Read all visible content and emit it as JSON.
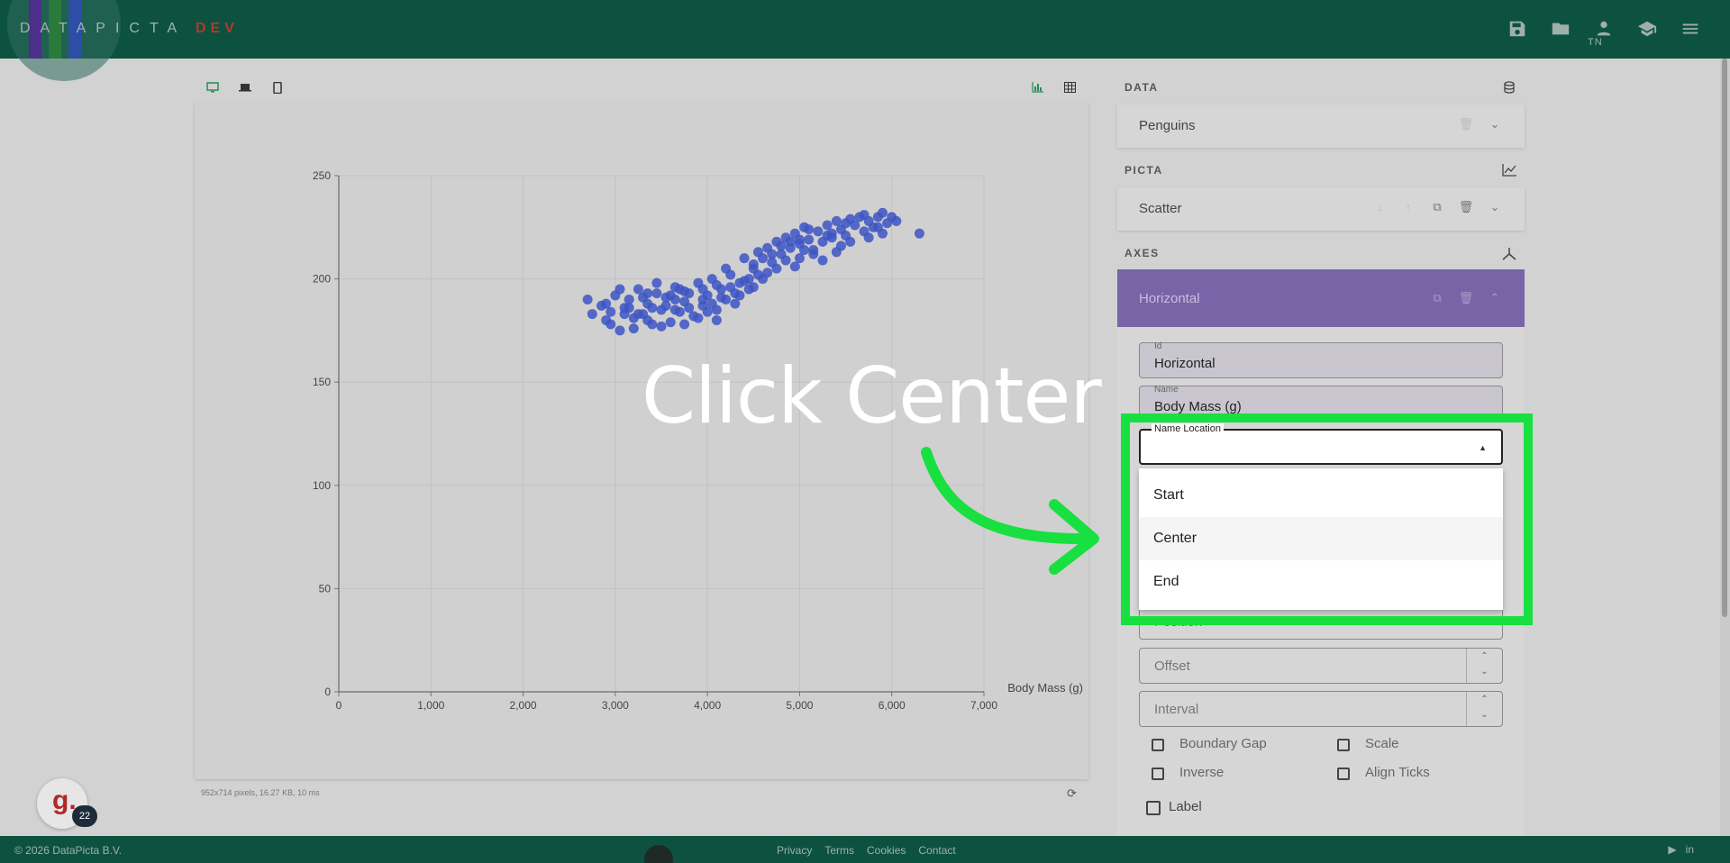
{
  "header": {
    "logo_text": "DATAPICTA",
    "logo_dev": "DEV",
    "user_initials": "TN",
    "icons": [
      "save-icon",
      "folder-icon",
      "user-icon",
      "school-icon",
      "menu-icon"
    ]
  },
  "toolbar": {
    "view_icons": [
      "desktop-icon",
      "laptop-icon",
      "phone-icon"
    ],
    "mode_icons": [
      "chart-icon",
      "table-icon"
    ]
  },
  "chart_data": {
    "type": "scatter",
    "title": "",
    "xlabel": "Body Mass (g)",
    "ylabel": "",
    "xlim": [
      0,
      7000
    ],
    "ylim": [
      0,
      250
    ],
    "x_ticks": [
      "0",
      "1,000",
      "2,000",
      "3,000",
      "4,000",
      "5,000",
      "6,000",
      "7,000"
    ],
    "y_ticks": [
      "0",
      "50",
      "100",
      "150",
      "200",
      "250"
    ],
    "grid": true,
    "point_color": "#3d55c4",
    "points": [
      [
        2700,
        190
      ],
      [
        2850,
        187
      ],
      [
        2900,
        180
      ],
      [
        2950,
        184
      ],
      [
        3000,
        192
      ],
      [
        3050,
        175
      ],
      [
        3100,
        186
      ],
      [
        3150,
        190
      ],
      [
        3200,
        181
      ],
      [
        3250,
        195
      ],
      [
        3300,
        183
      ],
      [
        3350,
        188
      ],
      [
        3400,
        178
      ],
      [
        3450,
        193
      ],
      [
        3500,
        185
      ],
      [
        3550,
        191
      ],
      [
        3600,
        179
      ],
      [
        3650,
        196
      ],
      [
        3700,
        184
      ],
      [
        3750,
        189
      ],
      [
        3800,
        193
      ],
      [
        3850,
        182
      ],
      [
        3900,
        198
      ],
      [
        3950,
        187
      ],
      [
        4000,
        192
      ],
      [
        4050,
        200
      ],
      [
        4100,
        185
      ],
      [
        4150,
        195
      ],
      [
        4200,
        190
      ],
      [
        4250,
        202
      ],
      [
        4300,
        188
      ],
      [
        4350,
        198
      ],
      [
        4400,
        210
      ],
      [
        4450,
        195
      ],
      [
        4500,
        205
      ],
      [
        4550,
        213
      ],
      [
        4600,
        200
      ],
      [
        4650,
        215
      ],
      [
        4700,
        208
      ],
      [
        4750,
        218
      ],
      [
        4800,
        212
      ],
      [
        4850,
        220
      ],
      [
        4900,
        215
      ],
      [
        4950,
        222
      ],
      [
        5000,
        217
      ],
      [
        5050,
        225
      ],
      [
        5100,
        219
      ],
      [
        5150,
        214
      ],
      [
        5200,
        223
      ],
      [
        5250,
        218
      ],
      [
        5300,
        226
      ],
      [
        5350,
        220
      ],
      [
        5400,
        228
      ],
      [
        5450,
        224
      ],
      [
        5500,
        221
      ],
      [
        5550,
        229
      ],
      [
        5600,
        226
      ],
      [
        5650,
        230
      ],
      [
        5700,
        223
      ],
      [
        5750,
        228
      ],
      [
        5800,
        225
      ],
      [
        5850,
        230
      ],
      [
        5900,
        222
      ],
      [
        5950,
        227
      ],
      [
        6000,
        230
      ],
      [
        6300,
        222
      ],
      [
        2900,
        188
      ],
      [
        3100,
        183
      ],
      [
        3300,
        191
      ],
      [
        3500,
        177
      ],
      [
        3700,
        195
      ],
      [
        3900,
        181
      ],
      [
        4100,
        197
      ],
      [
        4300,
        193
      ],
      [
        4500,
        207
      ],
      [
        4700,
        212
      ],
      [
        4900,
        218
      ],
      [
        5100,
        224
      ],
      [
        5300,
        221
      ],
      [
        5500,
        227
      ],
      [
        3200,
        176
      ],
      [
        3400,
        186
      ],
      [
        3600,
        192
      ],
      [
        3800,
        186
      ],
      [
        4000,
        184
      ],
      [
        4200,
        205
      ],
      [
        4400,
        199
      ],
      [
        4600,
        210
      ],
      [
        4800,
        216
      ],
      [
        5000,
        210
      ],
      [
        2750,
        183
      ],
      [
        3050,
        195
      ],
      [
        3350,
        180
      ],
      [
        3650,
        185
      ],
      [
        3950,
        190
      ],
      [
        4250,
        196
      ],
      [
        4550,
        202
      ],
      [
        4850,
        209
      ],
      [
        5150,
        212
      ],
      [
        5450,
        216
      ],
      [
        5750,
        220
      ],
      [
        3450,
        198
      ],
      [
        3750,
        178
      ],
      [
        4050,
        188
      ],
      [
        4350,
        192
      ],
      [
        4650,
        203
      ],
      [
        4950,
        206
      ],
      [
        5250,
        209
      ],
      [
        5550,
        218
      ],
      [
        5850,
        225
      ],
      [
        3150,
        186
      ],
      [
        3350,
        193
      ],
      [
        3550,
        187
      ],
      [
        3750,
        194
      ],
      [
        3950,
        195
      ],
      [
        4150,
        191
      ],
      [
        4450,
        200
      ],
      [
        4750,
        205
      ],
      [
        5050,
        214
      ],
      [
        5350,
        222
      ],
      [
        2950,
        178
      ],
      [
        3250,
        183
      ],
      [
        3650,
        190
      ],
      [
        4100,
        180
      ],
      [
        4500,
        196
      ],
      [
        5000,
        219
      ],
      [
        5400,
        213
      ],
      [
        5700,
        231
      ],
      [
        5900,
        232
      ],
      [
        6050,
        228
      ]
    ]
  },
  "chart_status": "952x714 pixels, 16.27 KB, 10 ms",
  "panel": {
    "data_label": "DATA",
    "data_value": "Penguins",
    "picta_label": "PICTA",
    "picta_value": "Scatter",
    "axes_label": "AXES",
    "axis_title": "Horizontal",
    "id_label": "Id",
    "id_value": "Horizontal",
    "name_label": "Name",
    "name_value": "Body Mass (g)",
    "name_location_label": "Name Location",
    "name_location_value": "",
    "options": [
      "Start",
      "Center",
      "End"
    ],
    "position_placeholder": "Position",
    "offset_placeholder": "Offset",
    "interval_placeholder": "Interval",
    "checkboxes": [
      "Boundary Gap",
      "Scale",
      "Inverse",
      "Align Ticks",
      "Label"
    ]
  },
  "overlay": {
    "instruction": "Click Center",
    "highlight_color": "#18e040"
  },
  "footer": {
    "copyright": "© 2026 DataPicta B.V.",
    "links": [
      "Privacy",
      "Terms",
      "Cookies",
      "Contact"
    ]
  },
  "badge": {
    "letter": "g.",
    "count": "22"
  }
}
